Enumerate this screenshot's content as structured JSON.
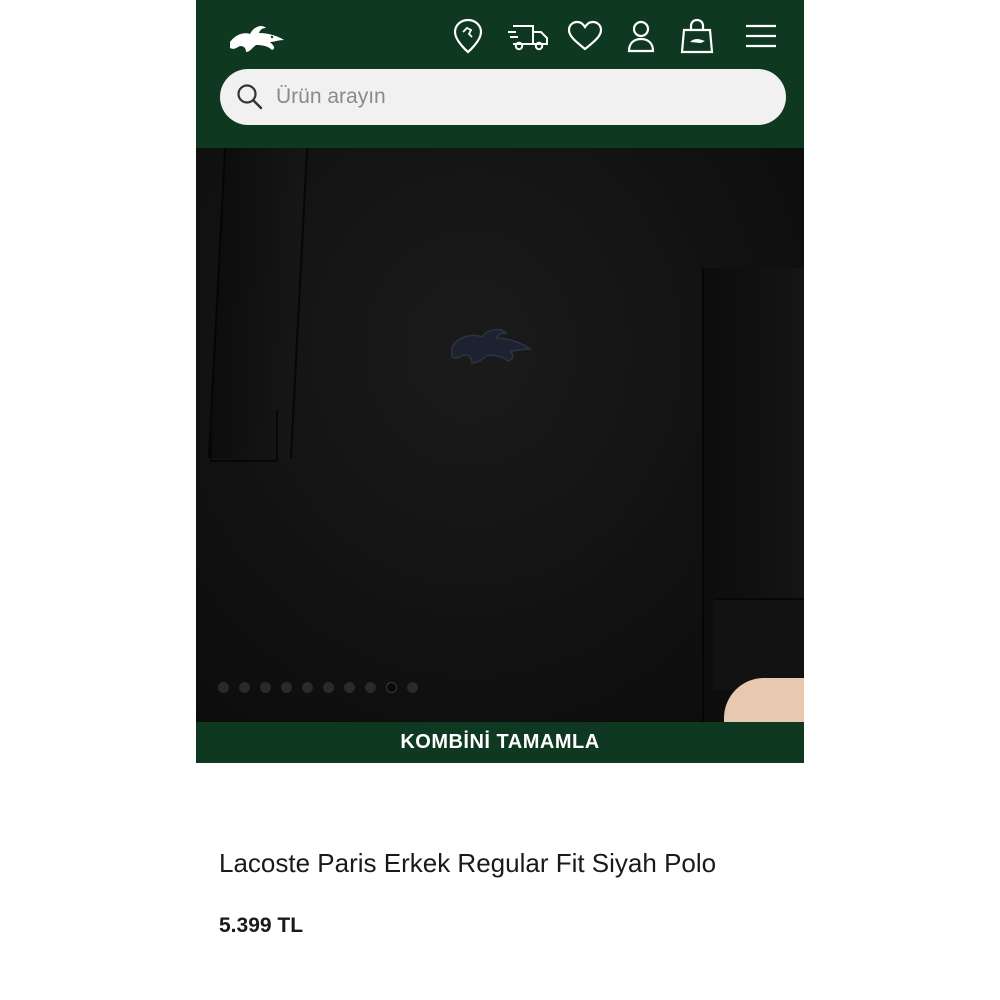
{
  "header": {
    "logo_icon": "crocodile-logo-icon",
    "icons": [
      "store-locator-icon",
      "delivery-truck-icon",
      "heart-icon",
      "user-icon",
      "shopping-bag-icon",
      "hamburger-menu-icon"
    ],
    "brand_color": "#0e3820"
  },
  "search": {
    "placeholder": "Ürün arayın",
    "icon": "search-icon"
  },
  "gallery": {
    "image_count": 10,
    "active_index": 8
  },
  "combine_button": {
    "label": "KOMBİNİ TAMAMLA"
  },
  "product": {
    "title": "Lacoste Paris Erkek Regular Fit Siyah Polo",
    "price": "5.399 TL"
  }
}
